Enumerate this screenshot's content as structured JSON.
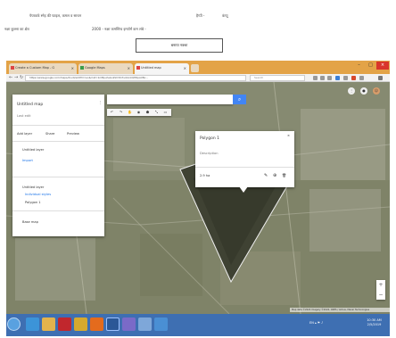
{
  "document": {
    "line1": "पेपरवर्क स्नेह की फाइल, कमल व साथन",
    "line1_right_a": "हैप्पी -",
    "line1_right_b": "कंप्यू",
    "line2": "नक्षा कुल्ला का क्षेत्र",
    "line2_mid": "2000 - नक्षा कमस्टिच इन्फॉर्म कम लंबे -",
    "form_box_label": "बनाया नक्शा"
  },
  "browser": {
    "tabs": [
      {
        "label": "Create a Custom Map - G",
        "active": false
      },
      {
        "label": "Google Maps",
        "active": false
      },
      {
        "label": "Untitled map",
        "active": true
      }
    ],
    "tab_close": "×",
    "window_min": "–",
    "window_max": "□",
    "window_close": "×",
    "back": "←",
    "forward": "→",
    "reload": "↻",
    "url": "https://www.google.com/maps/d/u/0/edit?hl=en&mid=1mBpuhsGnZxhVKi7sdnk4rQHRpAUNc...",
    "search_placeholder": "Search"
  },
  "map_editor": {
    "panel": {
      "title": "Untitled map",
      "subtitle": "Last edit",
      "actions": [
        "Add layer",
        "Share",
        "Preview"
      ],
      "layer_name": "Untitled layer",
      "import": "Import",
      "layer2_name": "Untitled layer",
      "style_label": "Individual styles",
      "item_name": "Polygon 1",
      "basemap": "Base map"
    },
    "search_icon": "⌕",
    "tools": [
      "↶",
      "↷",
      "✋",
      "◉",
      "⬟",
      "⤡",
      "▭"
    ],
    "popup": {
      "title": "Polygon 1",
      "subtitle": "Description",
      "footer": "2.9 ha",
      "icons": [
        "✎",
        "⊕",
        "🗑"
      ]
    },
    "zoom_in": "+",
    "zoom_out": "−",
    "attribution": "Map data ©2024 Imagery ©2024, CNES / Airbus, Maxar Technologies"
  },
  "taskbar": {
    "apps": [
      "ie",
      "explorer",
      "pdf",
      "chrome",
      "firefox",
      "word",
      "media",
      "paint",
      "network"
    ],
    "tray_text": "EN ▴ ⚑ ♪",
    "time": "10:30 AM",
    "date": "2/5/2019"
  }
}
